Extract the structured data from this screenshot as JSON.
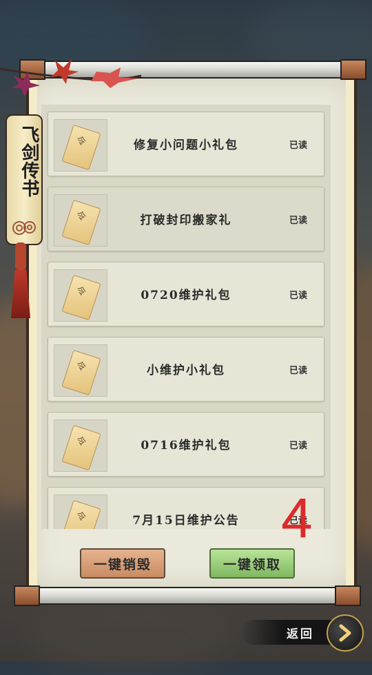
{
  "banner": {
    "title": "飞剑传书"
  },
  "mail_list": [
    {
      "title": "修复小问题小礼包",
      "status": "已读"
    },
    {
      "title": "打破封印搬家礼",
      "status": "已读"
    },
    {
      "title": "0720维护礼包",
      "status": "已读"
    },
    {
      "title": "小维护小礼包",
      "status": "已读"
    },
    {
      "title": "0716维护礼包",
      "status": "已读"
    },
    {
      "title": "7月15日维护公告",
      "status": "已读"
    }
  ],
  "envelope_glyph": "令",
  "buttons": {
    "destroy_all": "一键销毁",
    "claim_all": "一键领取"
  },
  "annotation": "4",
  "nav": {
    "back_label": "返回"
  },
  "colors": {
    "accent_red": "#dd2a2a",
    "claim_green": "#7fb860",
    "destroy_tan": "#c98b62"
  }
}
